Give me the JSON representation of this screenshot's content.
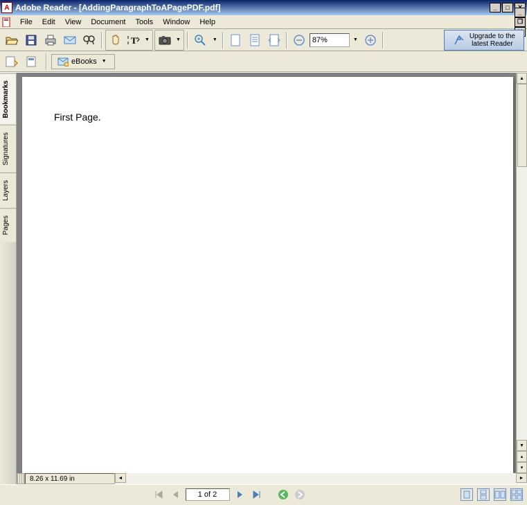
{
  "window": {
    "title": "Adobe Reader - [AddingParagraphToAPagePDF.pdf]"
  },
  "menus": {
    "file": "File",
    "edit": "Edit",
    "view": "View",
    "document": "Document",
    "tools": "Tools",
    "window": "Window",
    "help": "Help"
  },
  "toolbar": {
    "zoom_value": "87%",
    "upgrade_line1": "Upgrade to the",
    "upgrade_line2": "latest Reader",
    "ebooks_label": "eBooks"
  },
  "sidebar_tabs": {
    "bookmarks": "Bookmarks",
    "signatures": "Signatures",
    "layers": "Layers",
    "pages": "Pages"
  },
  "document": {
    "page_text": "First Page.",
    "dimensions": "8.26 x 11.69 in"
  },
  "nav": {
    "page_indicator": "1 of 2"
  }
}
